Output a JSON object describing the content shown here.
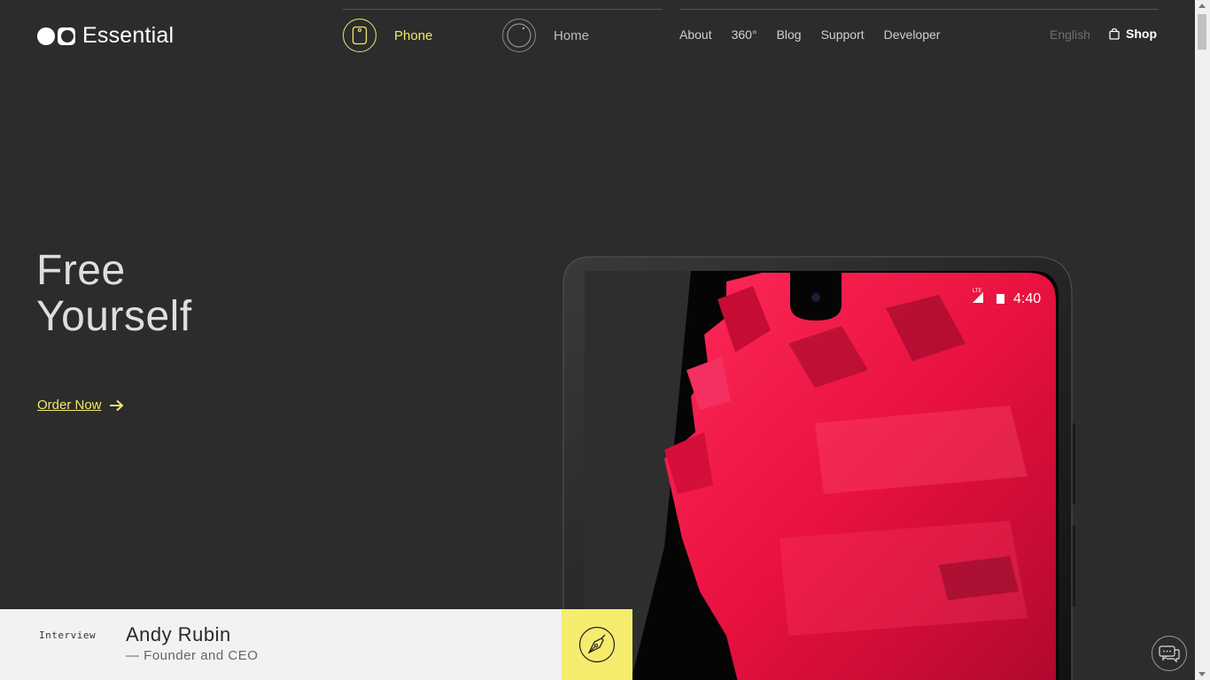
{
  "brand": {
    "name": "Essential"
  },
  "products": [
    {
      "label": "Phone",
      "icon": "phone-icon",
      "active": true
    },
    {
      "label": "Home",
      "icon": "home-device-icon",
      "active": false
    }
  ],
  "nav": {
    "items": [
      "About",
      "360°",
      "Blog",
      "Support",
      "Developer"
    ]
  },
  "language": "English",
  "shop": {
    "label": "Shop",
    "icon": "shopping-bag-icon"
  },
  "hero": {
    "title_line1": "Free",
    "title_line2": "Yourself",
    "cta": "Order Now",
    "cta_icon": "arrow-right-icon"
  },
  "phone_screen": {
    "time": "4:40",
    "network": "LTE"
  },
  "interview": {
    "tag": "Interview",
    "name": "Andy Rubin",
    "role": "— Founder and CEO",
    "icon": "pen-nib-icon"
  },
  "chat": {
    "icon": "chat-icon"
  },
  "colors": {
    "accent": "#f2e86d",
    "background": "#2c2c2c",
    "screen_red": "#e8113f",
    "panel": "#f2f1f3"
  }
}
